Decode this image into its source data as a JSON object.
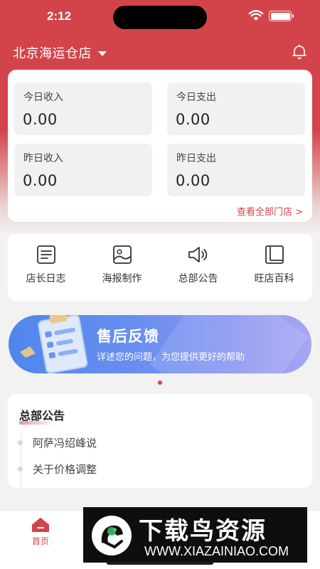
{
  "status_bar": {
    "time": "2:12"
  },
  "header": {
    "store_name": "北京海运仓店"
  },
  "summary": {
    "stats": [
      {
        "label": "今日收入",
        "value": "0.00"
      },
      {
        "label": "今日支出",
        "value": "0.00"
      },
      {
        "label": "昨日收入",
        "value": "0.00"
      },
      {
        "label": "昨日支出",
        "value": "0.00"
      }
    ],
    "view_all_label": "查看全部门店 >"
  },
  "quick_actions": [
    {
      "label": "店长日志",
      "icon": "document-lines-icon"
    },
    {
      "label": "海报制作",
      "icon": "image-icon"
    },
    {
      "label": "总部公告",
      "icon": "speaker-icon"
    },
    {
      "label": "旺店百科",
      "icon": "book-icon"
    }
  ],
  "banner": {
    "title": "售后反馈",
    "subtitle": "详述您的问题，为您提供更好的帮助",
    "active_slide": 1,
    "slide_count": 1
  },
  "notices": {
    "title": "总部公告",
    "items": [
      "阿萨冯绍峰说",
      "关于价格调整"
    ]
  },
  "tabbar": {
    "home_label": "首页"
  },
  "watermark": {
    "title": "下载鸟资源",
    "url": "WWW.XIAZAINIAO.COM"
  },
  "colors": {
    "brand_red": "#d2444a",
    "banner_blue": "#5b8bee",
    "page_bg": "#f2f2f2"
  }
}
